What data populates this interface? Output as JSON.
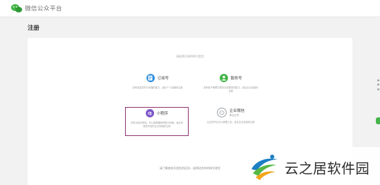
{
  "header": {
    "brand": "微信公众平台"
  },
  "page": {
    "title": "注册"
  },
  "panel": {
    "prompt": "请选择注册的帐号类型",
    "cards": [
      {
        "id": "subscription",
        "name": "订阅号",
        "sub": "",
        "icon": "document-icon",
        "icon_color": "#2f8fde",
        "desc": "具有信息发布与传播的能力，适合个人及媒体注册",
        "selected": false
      },
      {
        "id": "service",
        "name": "服务号",
        "sub": "",
        "icon": "person-icon",
        "icon_color": "#44b549",
        "desc": "具有用户管理与提供业务服务的能力，适合企业及组织注册",
        "selected": false
      },
      {
        "id": "miniprogram",
        "name": "小程序",
        "sub": "",
        "icon": "miniprogram-icon",
        "icon_color": "#7c55c9",
        "desc": "具有出色的体验，可以被便捷地获取与传播，适合有服务内容的企业和组织注册",
        "selected": true
      },
      {
        "id": "enterprise",
        "name": "企业微信",
        "sub": "原企业号",
        "icon": "enterprise-chat-icon",
        "icon_color": "#9aa0a6",
        "desc": "企业的专业办公管理工具，适合企业及组织注册",
        "selected": false
      }
    ],
    "footer_note": "请了解各帐号类型的区别，选择适合你的帐号类型"
  },
  "colors": {
    "selected_border": "#8b2f6b",
    "brand_green": "#44b549",
    "page_bg": "#f2f2f2"
  },
  "watermark": {
    "text": "云之居软件园"
  }
}
